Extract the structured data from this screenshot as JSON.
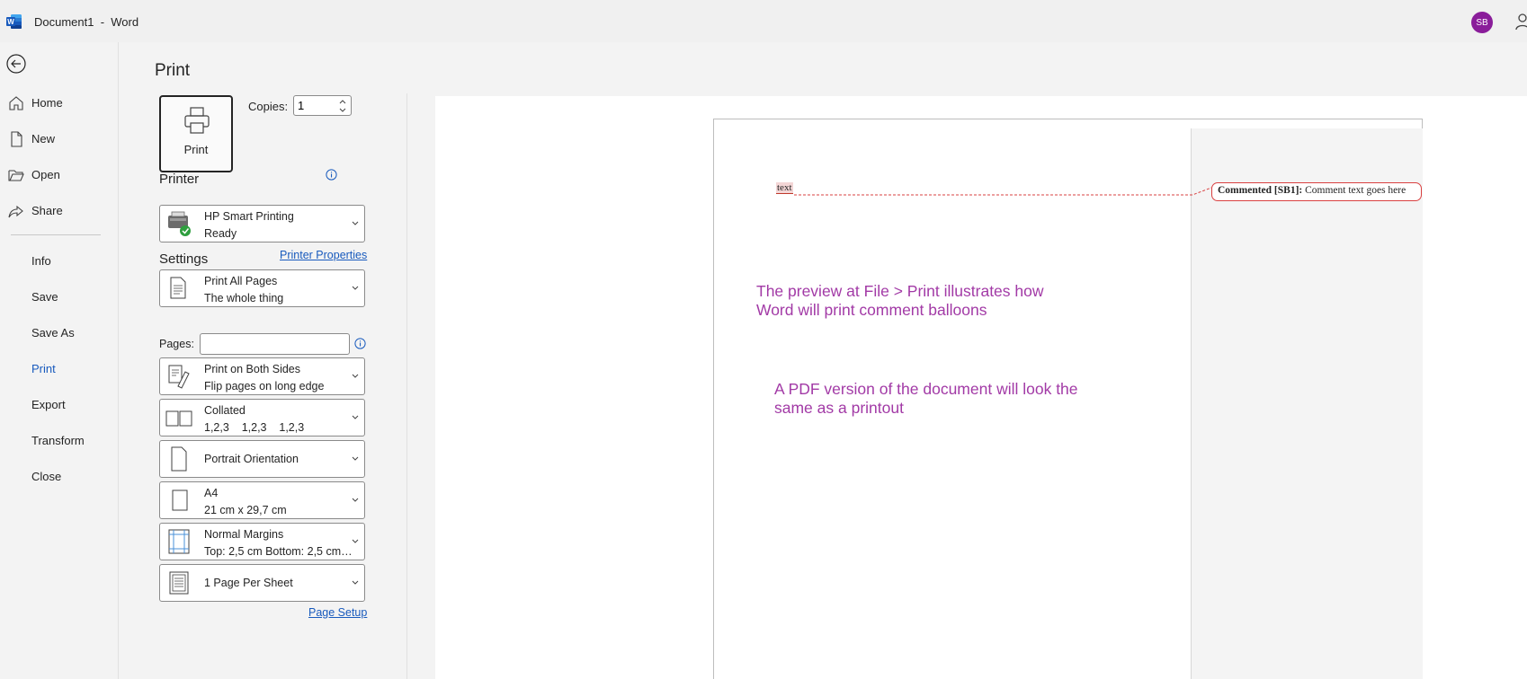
{
  "app": {
    "title": "Document1  -  Word",
    "avatar_initials": "SB",
    "logo_letter": "W",
    "accent": "#185abd",
    "avatar_color": "#8a1d9a"
  },
  "nav": {
    "items": [
      {
        "label": "Home",
        "icon": "home-icon"
      },
      {
        "label": "New",
        "icon": "new-document-icon"
      },
      {
        "label": "Open",
        "icon": "folder-icon"
      },
      {
        "label": "Share",
        "icon": "share-icon"
      },
      {
        "label": "Info"
      },
      {
        "label": "Save"
      },
      {
        "label": "Save As"
      },
      {
        "label": "Print",
        "active": true
      },
      {
        "label": "Export"
      },
      {
        "label": "Transform"
      },
      {
        "label": "Close"
      }
    ]
  },
  "print": {
    "title": "Print",
    "button_label": "Print",
    "copies_label": "Copies:",
    "copies_value": "1",
    "printer_heading": "Printer",
    "printer_name": "HP Smart Printing",
    "printer_status": "Ready",
    "printer_properties": "Printer Properties",
    "settings_heading": "Settings",
    "pages_label": "Pages:",
    "pages_value": "",
    "range_line1": "Print All Pages",
    "range_line2": "The whole thing",
    "sides_line1": "Print on Both Sides",
    "sides_line2": "Flip pages on long edge",
    "collate_line1": "Collated",
    "collate_line2": "1,2,3    1,2,3    1,2,3",
    "orientation": "Portrait Orientation",
    "paper_line1": "A4",
    "paper_line2": "21 cm x 29,7 cm",
    "margins_line1": "Normal Margins",
    "margins_line2": "Top: 2,5 cm Bottom: 2,5 cm L...",
    "per_sheet": "1 Page Per Sheet",
    "page_setup": "Page Setup"
  },
  "preview": {
    "commented_word": "text",
    "comment_label": "Commented [SB1]:",
    "comment_text": " Comment text goes here",
    "note1_line1": "The preview at File > Print illustrates how",
    "note1_line2": "Word will print comment balloons",
    "note2_line1": "A PDF version of the document will look the",
    "note2_line2": "same as a printout",
    "note_color": "#a23aa6"
  }
}
